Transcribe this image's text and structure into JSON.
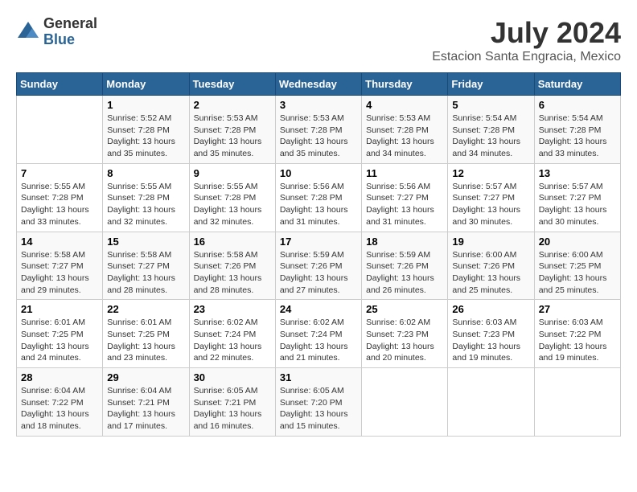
{
  "header": {
    "logo_general": "General",
    "logo_blue": "Blue",
    "month_title": "July 2024",
    "location": "Estacion Santa Engracia, Mexico"
  },
  "days_of_week": [
    "Sunday",
    "Monday",
    "Tuesday",
    "Wednesday",
    "Thursday",
    "Friday",
    "Saturday"
  ],
  "weeks": [
    [
      {
        "day": "",
        "sunrise": "",
        "sunset": "",
        "daylight": ""
      },
      {
        "day": "1",
        "sunrise": "Sunrise: 5:52 AM",
        "sunset": "Sunset: 7:28 PM",
        "daylight": "Daylight: 13 hours and 35 minutes."
      },
      {
        "day": "2",
        "sunrise": "Sunrise: 5:53 AM",
        "sunset": "Sunset: 7:28 PM",
        "daylight": "Daylight: 13 hours and 35 minutes."
      },
      {
        "day": "3",
        "sunrise": "Sunrise: 5:53 AM",
        "sunset": "Sunset: 7:28 PM",
        "daylight": "Daylight: 13 hours and 35 minutes."
      },
      {
        "day": "4",
        "sunrise": "Sunrise: 5:53 AM",
        "sunset": "Sunset: 7:28 PM",
        "daylight": "Daylight: 13 hours and 34 minutes."
      },
      {
        "day": "5",
        "sunrise": "Sunrise: 5:54 AM",
        "sunset": "Sunset: 7:28 PM",
        "daylight": "Daylight: 13 hours and 34 minutes."
      },
      {
        "day": "6",
        "sunrise": "Sunrise: 5:54 AM",
        "sunset": "Sunset: 7:28 PM",
        "daylight": "Daylight: 13 hours and 33 minutes."
      }
    ],
    [
      {
        "day": "7",
        "sunrise": "Sunrise: 5:55 AM",
        "sunset": "Sunset: 7:28 PM",
        "daylight": "Daylight: 13 hours and 33 minutes."
      },
      {
        "day": "8",
        "sunrise": "Sunrise: 5:55 AM",
        "sunset": "Sunset: 7:28 PM",
        "daylight": "Daylight: 13 hours and 32 minutes."
      },
      {
        "day": "9",
        "sunrise": "Sunrise: 5:55 AM",
        "sunset": "Sunset: 7:28 PM",
        "daylight": "Daylight: 13 hours and 32 minutes."
      },
      {
        "day": "10",
        "sunrise": "Sunrise: 5:56 AM",
        "sunset": "Sunset: 7:28 PM",
        "daylight": "Daylight: 13 hours and 31 minutes."
      },
      {
        "day": "11",
        "sunrise": "Sunrise: 5:56 AM",
        "sunset": "Sunset: 7:27 PM",
        "daylight": "Daylight: 13 hours and 31 minutes."
      },
      {
        "day": "12",
        "sunrise": "Sunrise: 5:57 AM",
        "sunset": "Sunset: 7:27 PM",
        "daylight": "Daylight: 13 hours and 30 minutes."
      },
      {
        "day": "13",
        "sunrise": "Sunrise: 5:57 AM",
        "sunset": "Sunset: 7:27 PM",
        "daylight": "Daylight: 13 hours and 30 minutes."
      }
    ],
    [
      {
        "day": "14",
        "sunrise": "Sunrise: 5:58 AM",
        "sunset": "Sunset: 7:27 PM",
        "daylight": "Daylight: 13 hours and 29 minutes."
      },
      {
        "day": "15",
        "sunrise": "Sunrise: 5:58 AM",
        "sunset": "Sunset: 7:27 PM",
        "daylight": "Daylight: 13 hours and 28 minutes."
      },
      {
        "day": "16",
        "sunrise": "Sunrise: 5:58 AM",
        "sunset": "Sunset: 7:26 PM",
        "daylight": "Daylight: 13 hours and 28 minutes."
      },
      {
        "day": "17",
        "sunrise": "Sunrise: 5:59 AM",
        "sunset": "Sunset: 7:26 PM",
        "daylight": "Daylight: 13 hours and 27 minutes."
      },
      {
        "day": "18",
        "sunrise": "Sunrise: 5:59 AM",
        "sunset": "Sunset: 7:26 PM",
        "daylight": "Daylight: 13 hours and 26 minutes."
      },
      {
        "day": "19",
        "sunrise": "Sunrise: 6:00 AM",
        "sunset": "Sunset: 7:26 PM",
        "daylight": "Daylight: 13 hours and 25 minutes."
      },
      {
        "day": "20",
        "sunrise": "Sunrise: 6:00 AM",
        "sunset": "Sunset: 7:25 PM",
        "daylight": "Daylight: 13 hours and 25 minutes."
      }
    ],
    [
      {
        "day": "21",
        "sunrise": "Sunrise: 6:01 AM",
        "sunset": "Sunset: 7:25 PM",
        "daylight": "Daylight: 13 hours and 24 minutes."
      },
      {
        "day": "22",
        "sunrise": "Sunrise: 6:01 AM",
        "sunset": "Sunset: 7:25 PM",
        "daylight": "Daylight: 13 hours and 23 minutes."
      },
      {
        "day": "23",
        "sunrise": "Sunrise: 6:02 AM",
        "sunset": "Sunset: 7:24 PM",
        "daylight": "Daylight: 13 hours and 22 minutes."
      },
      {
        "day": "24",
        "sunrise": "Sunrise: 6:02 AM",
        "sunset": "Sunset: 7:24 PM",
        "daylight": "Daylight: 13 hours and 21 minutes."
      },
      {
        "day": "25",
        "sunrise": "Sunrise: 6:02 AM",
        "sunset": "Sunset: 7:23 PM",
        "daylight": "Daylight: 13 hours and 20 minutes."
      },
      {
        "day": "26",
        "sunrise": "Sunrise: 6:03 AM",
        "sunset": "Sunset: 7:23 PM",
        "daylight": "Daylight: 13 hours and 19 minutes."
      },
      {
        "day": "27",
        "sunrise": "Sunrise: 6:03 AM",
        "sunset": "Sunset: 7:22 PM",
        "daylight": "Daylight: 13 hours and 19 minutes."
      }
    ],
    [
      {
        "day": "28",
        "sunrise": "Sunrise: 6:04 AM",
        "sunset": "Sunset: 7:22 PM",
        "daylight": "Daylight: 13 hours and 18 minutes."
      },
      {
        "day": "29",
        "sunrise": "Sunrise: 6:04 AM",
        "sunset": "Sunset: 7:21 PM",
        "daylight": "Daylight: 13 hours and 17 minutes."
      },
      {
        "day": "30",
        "sunrise": "Sunrise: 6:05 AM",
        "sunset": "Sunset: 7:21 PM",
        "daylight": "Daylight: 13 hours and 16 minutes."
      },
      {
        "day": "31",
        "sunrise": "Sunrise: 6:05 AM",
        "sunset": "Sunset: 7:20 PM",
        "daylight": "Daylight: 13 hours and 15 minutes."
      },
      {
        "day": "",
        "sunrise": "",
        "sunset": "",
        "daylight": ""
      },
      {
        "day": "",
        "sunrise": "",
        "sunset": "",
        "daylight": ""
      },
      {
        "day": "",
        "sunrise": "",
        "sunset": "",
        "daylight": ""
      }
    ]
  ]
}
